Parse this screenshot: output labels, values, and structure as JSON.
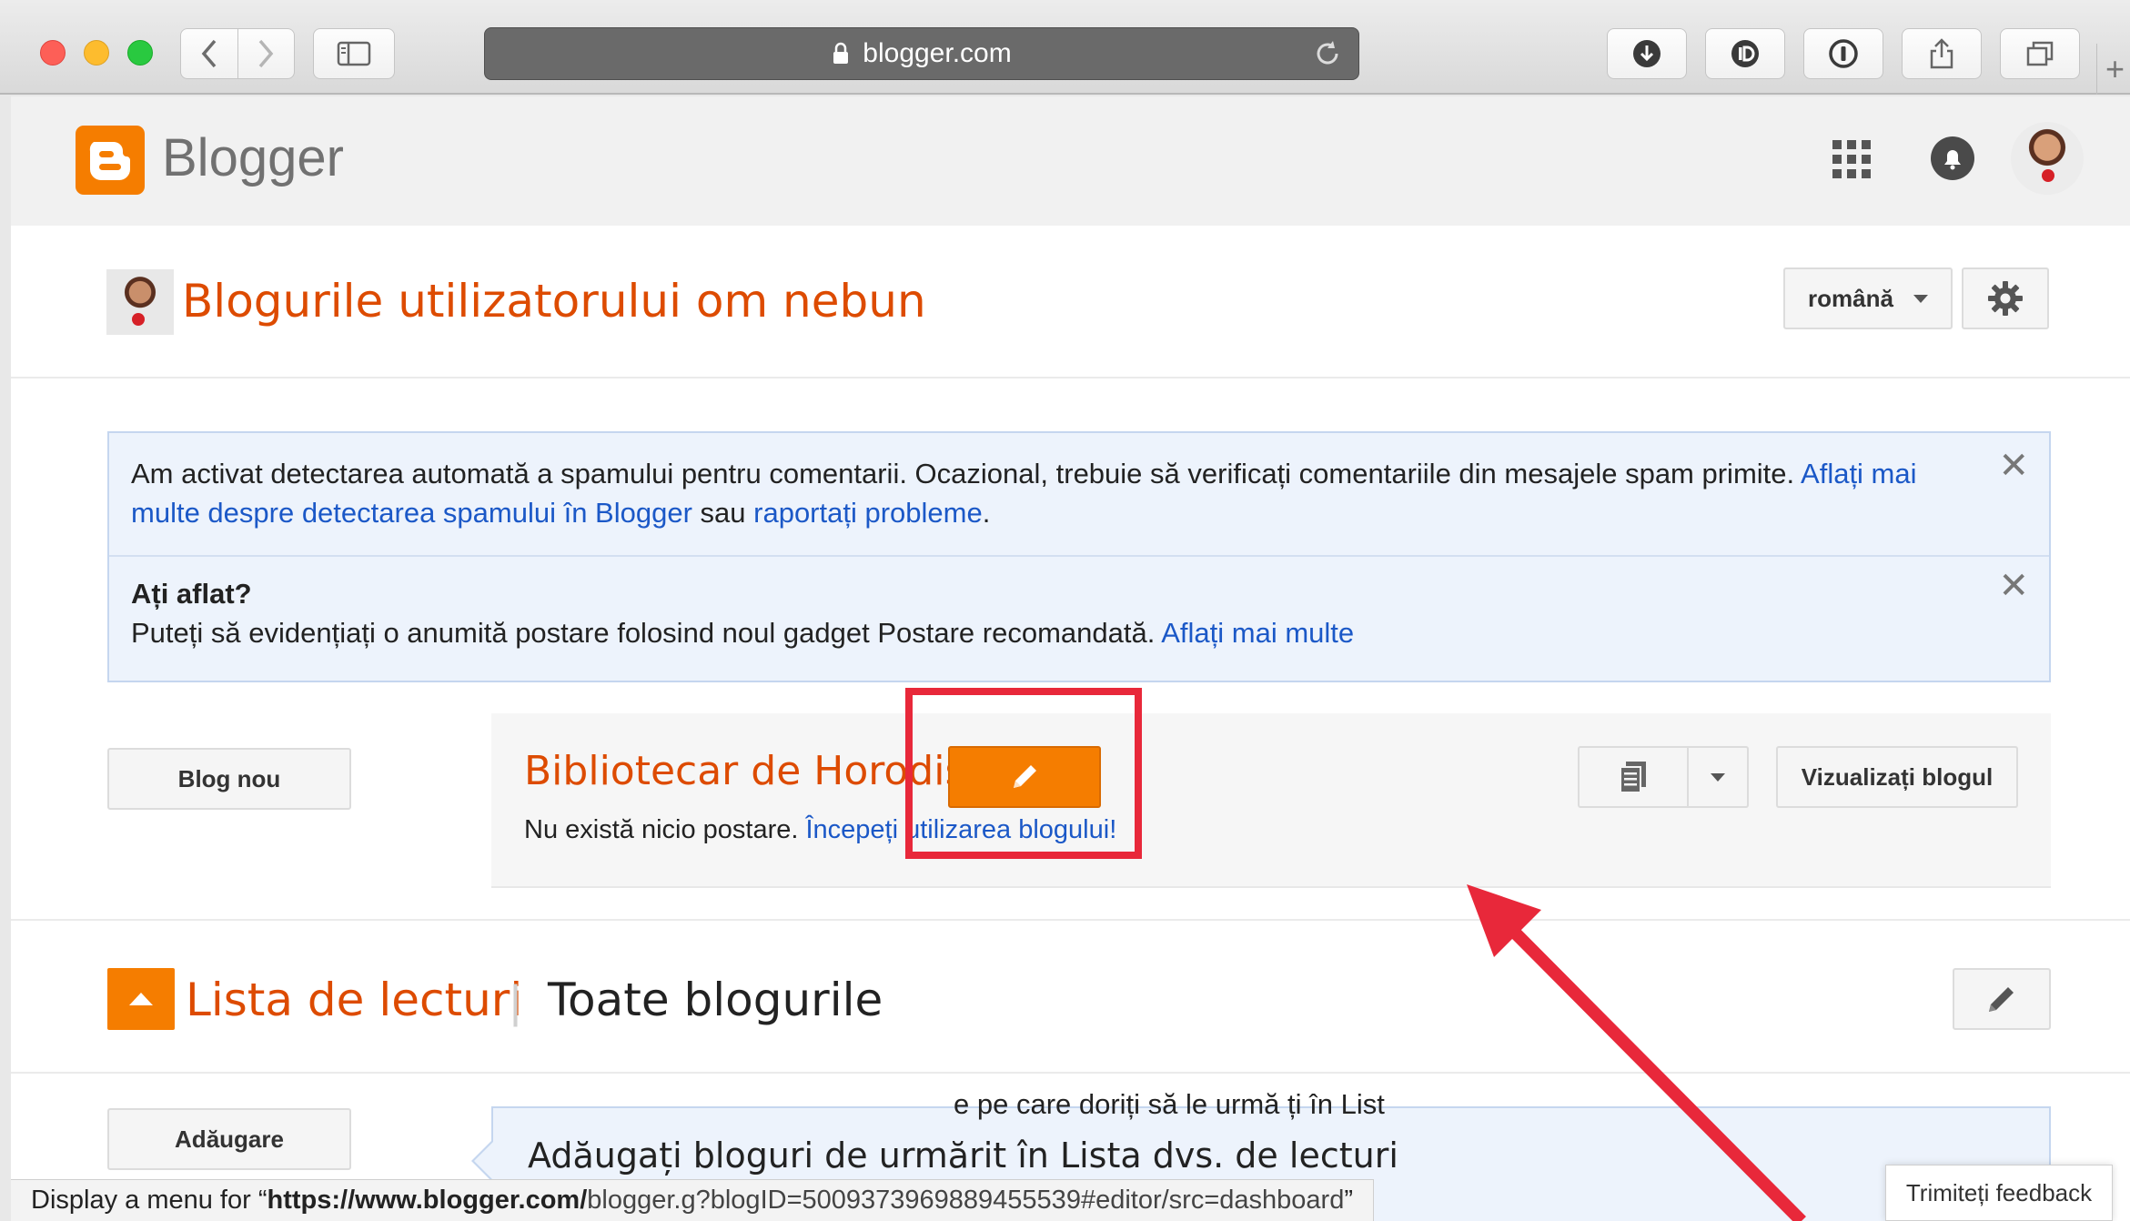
{
  "browser": {
    "url_display": "blogger.com",
    "back_glyph": "‹",
    "forward_glyph": "›",
    "new_tab_glyph": "+"
  },
  "appbar": {
    "logo_text": "Blogger"
  },
  "header": {
    "title": "Blogurile utilizatorului om nebun",
    "language": "română"
  },
  "notices": {
    "spam": {
      "text": "Am activat detectarea automată a spamului pentru comentarii. Ocazional, trebuie să verificați comentariile din mesajele spam primite. ",
      "link1": "Aflați mai multe despre detectarea spamului în Blogger",
      "middle": " sau ",
      "link2": "raportați probleme",
      "end": "."
    },
    "tip": {
      "title": "Ați aflat?",
      "text": "Puteți să evidențiați o anumită postare folosind noul gadget Postare recomandată. ",
      "link": "Aflați mai multe"
    },
    "close_glyph": "✕"
  },
  "blogs": {
    "new_blog_label": "Blog nou",
    "items": [
      {
        "name": "Bibliotecar de Horodiște",
        "status": "Nu există nicio postare. ",
        "start_link": "Începeți utilizarea blogului!",
        "view_label": "Vizualizați blogul"
      }
    ]
  },
  "reading_list": {
    "title": "Lista de lecturi",
    "separator": "|",
    "filter": "Toate blogurile",
    "add_label": "Adăugare",
    "panel_title": "Adăugați bloguri de urmărit în Lista dvs. de lecturi",
    "panel_text_fragment": "e pe care doriți să le urmă   ți în List"
  },
  "status_bar": {
    "prefix": "Display a menu for “",
    "url_host": "https://www.blogger.com/",
    "url_path": "blogger.g?blogID=5009373969889455539#editor/src=dashboard",
    "suffix": "”"
  },
  "feedback_label": "Trimiteți feedback",
  "colors": {
    "accent_orange": "#f57d00",
    "title_orange": "#dd4b00",
    "link_blue": "#1b58c7",
    "annotation_red": "#e8283a"
  }
}
